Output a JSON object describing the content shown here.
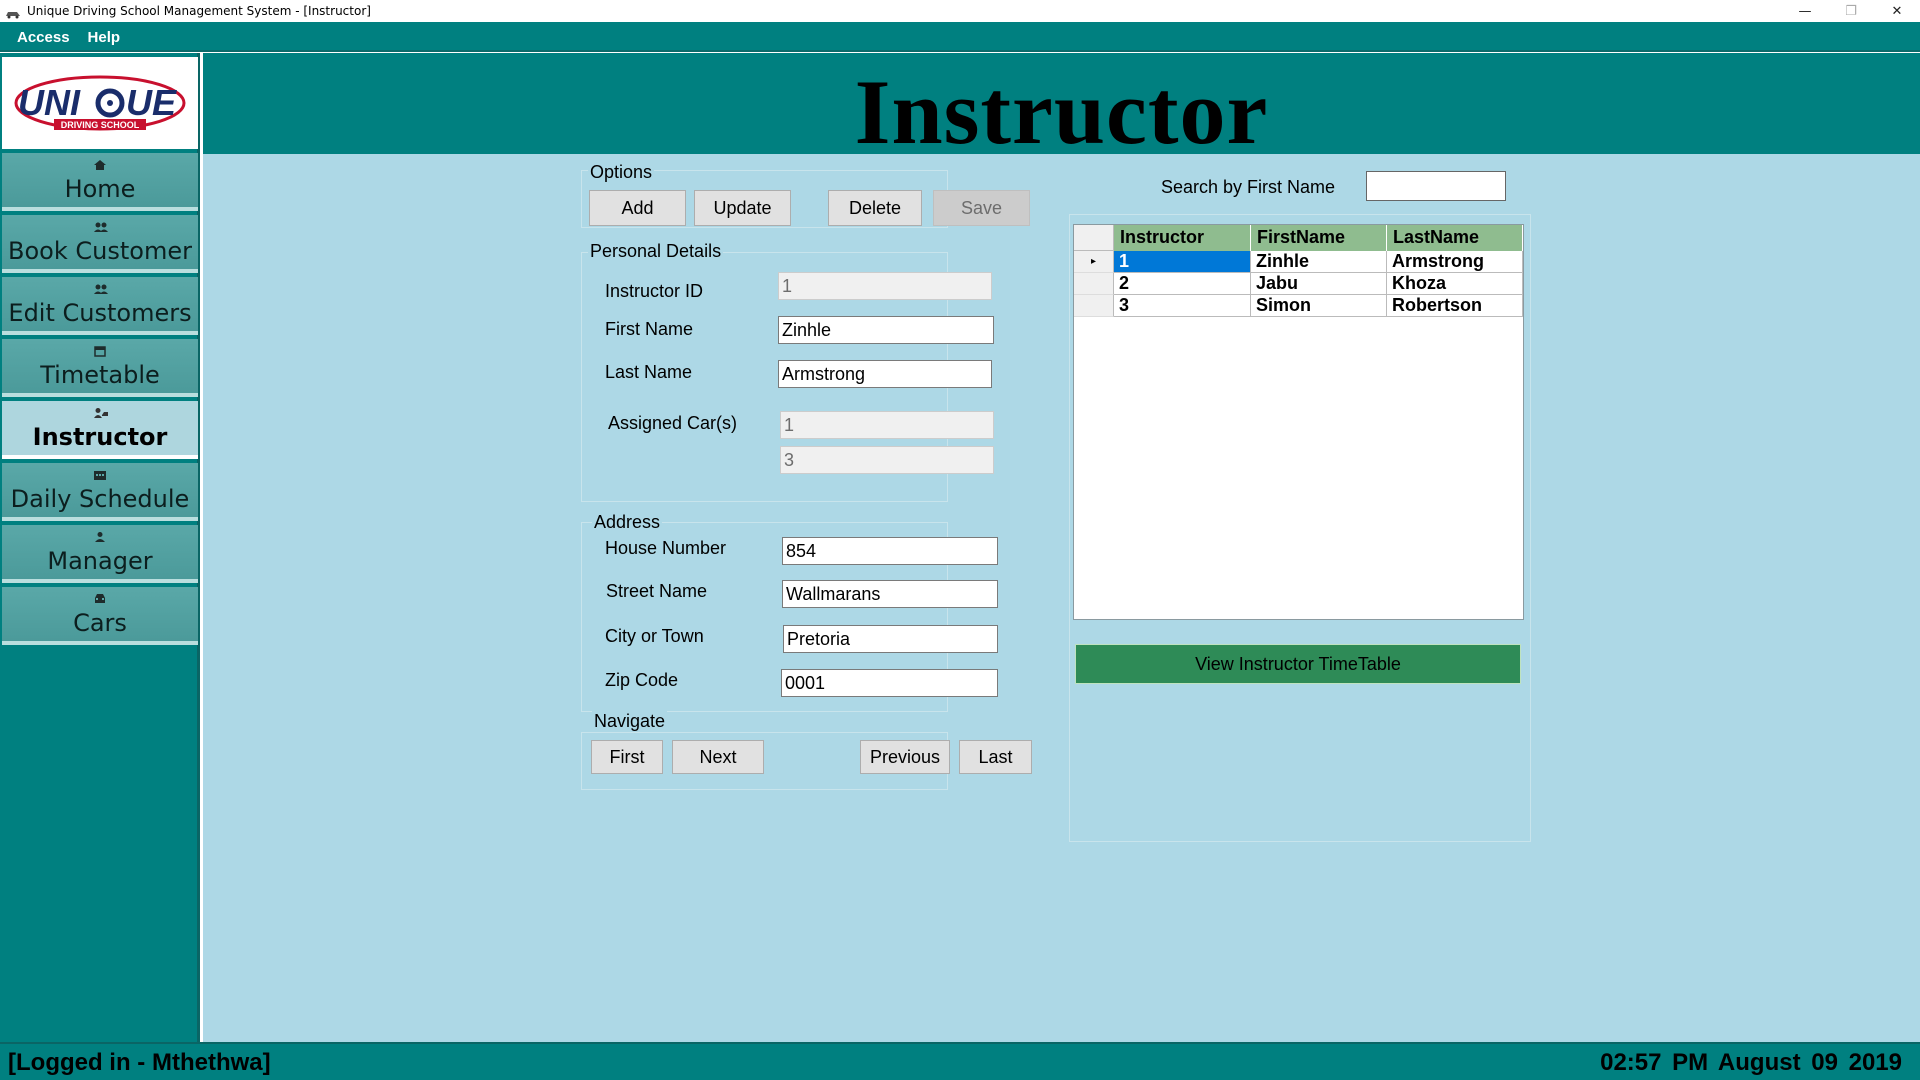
{
  "window": {
    "title": "Unique Driving School Management System - [Instructor]",
    "minimize_glyph": "—",
    "restore_glyph": "❐",
    "close_glyph": "✕"
  },
  "menu": [
    {
      "label": "Access"
    },
    {
      "label": "Help"
    }
  ],
  "logo": {
    "text_left": "UNI",
    "text_right": "UE",
    "tagline": "DRIVING SCHOOL"
  },
  "sidebar": {
    "items": [
      {
        "label": "Home",
        "icon": "home-icon"
      },
      {
        "label": "Book Customer",
        "icon": "users-icon"
      },
      {
        "label": "Edit Customers",
        "icon": "users-edit-icon"
      },
      {
        "label": "Timetable",
        "icon": "calendar-icon"
      },
      {
        "label": "Instructor",
        "icon": "instructor-icon"
      },
      {
        "label": "Daily Schedule",
        "icon": "schedule-icon"
      },
      {
        "label": "Manager",
        "icon": "person-icon"
      },
      {
        "label": "Cars",
        "icon": "car-icon"
      }
    ],
    "active_index": 4
  },
  "header": {
    "title": "Instructor"
  },
  "options": {
    "title": "Options",
    "add": "Add",
    "update": "Update",
    "delete": "Delete",
    "save": "Save"
  },
  "personal": {
    "title": "Personal Details",
    "id_label": "Instructor ID",
    "id_value": "1",
    "first_label": "First Name",
    "first_value": "Zinhle",
    "last_label": "Last Name",
    "last_value": "Armstrong",
    "cars_label": "Assigned Car(s)",
    "car1": "1",
    "car2": "3"
  },
  "address": {
    "title": "Address",
    "house_label": "House Number",
    "house_value": "854",
    "street_label": "Street Name",
    "street_value": "Wallmarans",
    "city_label": "City or Town",
    "city_value": "Pretoria",
    "zip_label": "Zip Code",
    "zip_value": "0001"
  },
  "navigate": {
    "title": "Navigate",
    "first": "First",
    "next": "Next",
    "previous": "Previous",
    "last": "Last"
  },
  "search": {
    "label": "Search by First Name",
    "value": ""
  },
  "grid": {
    "columns": [
      "Instructor",
      "FirstName",
      "LastName"
    ],
    "rows": [
      {
        "id": "1",
        "first": "Zinhle",
        "last": "Armstrong",
        "selected": true
      },
      {
        "id": "2",
        "first": "Jabu",
        "last": "Khoza",
        "selected": false
      },
      {
        "id": "3",
        "first": "Simon",
        "last": "Robertson",
        "selected": false
      }
    ],
    "row_indicator": "▸"
  },
  "view_timetable": "View Instructor TimeTable",
  "status": {
    "user": "[Logged in -  Mthethwa]",
    "time": "02:57 PM  August  09  2019"
  },
  "colors": {
    "teal": "#008080",
    "content_bg": "#add8e6",
    "grid_header": "#8fbc8f",
    "selection": "#0078d7",
    "timetable_button": "#2e8b57"
  }
}
